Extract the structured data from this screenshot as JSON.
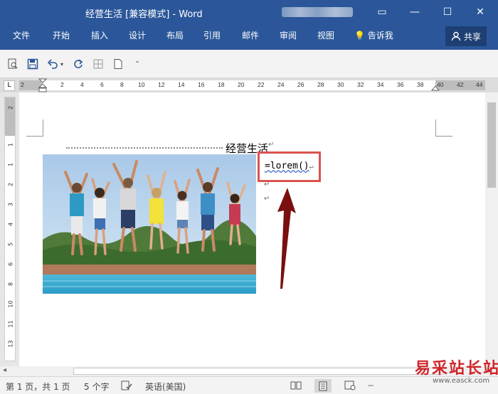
{
  "window": {
    "title": "经营生活 [兼容模式] - Word",
    "minimize_icon": "▭",
    "restore_icon": "—",
    "maximize_icon": "☐",
    "close_icon": "✕"
  },
  "ribbon": {
    "tabs": [
      "文件",
      "开始",
      "插入",
      "设计",
      "布局",
      "引用",
      "邮件",
      "审阅",
      "视图"
    ],
    "tell_me": "告诉我",
    "share": "共享"
  },
  "ruler": {
    "numbers": [
      "2",
      "2",
      "4",
      "6",
      "8",
      "10",
      "12",
      "14",
      "16",
      "18",
      "20",
      "22",
      "24",
      "26",
      "28",
      "30",
      "32",
      "34",
      "36",
      "38",
      "40",
      "42",
      "44"
    ],
    "vertical_numbers": [
      "2",
      "1",
      "1",
      "2",
      "3",
      "4",
      "5",
      "6",
      "7",
      "8",
      "9",
      "10",
      "11",
      "12",
      "13"
    ],
    "tab_stop": "L"
  },
  "document": {
    "heading": "经营生活",
    "paragraph_mark": "↵",
    "formula": "=lorem()",
    "textbox_border_color": "#d9534f",
    "arrow_color": "#7a0f0f"
  },
  "statusbar": {
    "page": "第 1 页，共 1 页",
    "words": "5 个字",
    "language": "英语(美国)"
  },
  "watermark": {
    "text": "易采站长站",
    "url": "www.easck.com"
  }
}
